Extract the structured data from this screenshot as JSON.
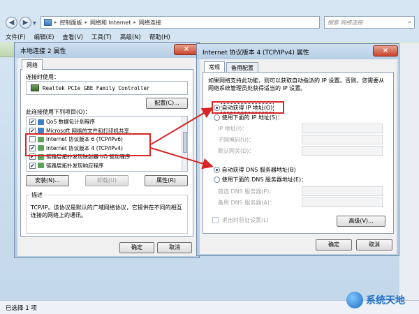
{
  "explorer": {
    "breadcrumb": [
      "控制面板",
      "网络和 Internet",
      "网络连接"
    ],
    "search_placeholder": "搜索 网络连接",
    "menu": [
      "文件(F)",
      "编辑(E)",
      "查看(V)",
      "工具(T)",
      "高级(N)",
      "帮助(H)"
    ],
    "status": "已选择 1 项"
  },
  "watermark": {
    "text": "系统天地"
  },
  "left_dialog": {
    "title": "本地连接 2 属性",
    "close": "×",
    "tab": "网络",
    "connect_using_label": "连接时使用：",
    "adapter": "Realtek PCIe GBE Family Controller",
    "configure_button": "配置(C)...",
    "items_label": "此连接使用下列项目(O)：",
    "items": [
      {
        "checked": true,
        "text": "QoS 数据包计划程序",
        "icon_color": "#3f7fc7"
      },
      {
        "checked": true,
        "text": "Microsoft 网络的文件和打印机共享",
        "icon_color": "#3f7fc7"
      },
      {
        "checked": false,
        "text": "Internet 协议版本 6 (TCP/IPv6)",
        "icon_color": "#5aa35a"
      },
      {
        "checked": true,
        "text": "Internet 协议版本 4 (TCP/IPv4)",
        "icon_color": "#5aa35a"
      },
      {
        "checked": true,
        "text": "链路层拓扑发现映射器 I/O 驱动程序",
        "icon_color": "#5aa35a"
      },
      {
        "checked": true,
        "text": "链路层拓扑发现响应程序",
        "icon_color": "#5aa35a"
      }
    ],
    "install_button": "安装(N)...",
    "uninstall_button": "卸载(U)",
    "properties_button": "属性(R)",
    "description_title": "描述",
    "description": "TCP/IP。该协议是默认的广域网络协议，它提供在不同的相互连接的网络上的通讯。",
    "ok_button": "确定",
    "cancel_button": "取消"
  },
  "right_dialog": {
    "title": "Internet 协议版本 4 (TCP/IPv4) 属性",
    "close": "×",
    "tab_general": "常规",
    "tab_alternate": "备用配置",
    "intro": "如果网络支持此功能，则可以获取自动指派的 IP 设置。否则，您需要从网络系统管理员处获得适当的 IP 设置。",
    "auto_ip": "自动获得 IP 地址(O)",
    "manual_ip": "使用下面的 IP 地址(S)：",
    "ip_address": "IP 地址(I)：",
    "subnet_mask": "子网掩码(U)：",
    "default_gateway": "默认网关(D)：",
    "auto_dns": "自动获得 DNS 服务器地址(B)",
    "manual_dns": "使用下面的 DNS 服务器地址(E)：",
    "preferred_dns": "首选 DNS 服务器(P)：",
    "alternate_dns": "备用 DNS 服务器(A)：",
    "validate_on_exit": "退出时验证设置(L)",
    "advanced_button": "高级(V)...",
    "ok_button": "确定",
    "cancel_button": "取消"
  },
  "colors": {
    "annotation": "#d82525",
    "title_bar": "#c3d7ea",
    "dialog_bg": "#f0f0f0"
  }
}
